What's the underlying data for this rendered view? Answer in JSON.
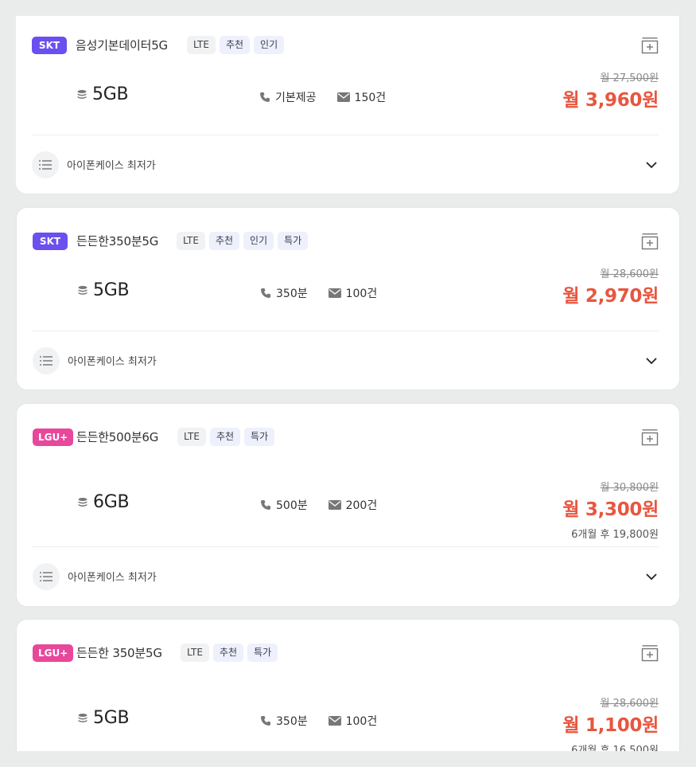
{
  "colors": {
    "skt": "#6b4ff0",
    "lgu": "#e8479b",
    "price": "#e8563f"
  },
  "icons": {
    "favorite": "add-to-list-icon",
    "data": "database-icon",
    "voice": "phone-icon",
    "sms": "mail-icon",
    "promo": "list-icon",
    "expand": "chevron-down-icon"
  },
  "plans": [
    {
      "carrier": "SKT",
      "name": "음성기본데이터5G",
      "tags": [
        "LTE",
        "추천",
        "인기"
      ],
      "data": "5GB",
      "voice": "기본제공",
      "sms": "150건",
      "original_price": "월 27,500원",
      "price": "월 3,960원",
      "after_price": "",
      "promo": "아이폰케이스 최저가"
    },
    {
      "carrier": "SKT",
      "name": "든든한350분5G",
      "tags": [
        "LTE",
        "추천",
        "인기",
        "특가"
      ],
      "data": "5GB",
      "voice": "350분",
      "sms": "100건",
      "original_price": "월 28,600원",
      "price": "월 2,970원",
      "after_price": "",
      "promo": "아이폰케이스 최저가"
    },
    {
      "carrier": "LGU+",
      "name": "든든한500분6G",
      "tags": [
        "LTE",
        "추천",
        "특가"
      ],
      "data": "6GB",
      "voice": "500분",
      "sms": "200건",
      "original_price": "월 30,800원",
      "price": "월 3,300원",
      "after_price": "6개월 후 19,800원",
      "promo": "아이폰케이스 최저가"
    },
    {
      "carrier": "LGU+",
      "name": "든든한 350분5G",
      "tags": [
        "LTE",
        "추천",
        "특가"
      ],
      "data": "5GB",
      "voice": "350분",
      "sms": "100건",
      "original_price": "월 28,600원",
      "price": "월 1,100원",
      "after_price": "6개월 후 16,500원",
      "promo": ""
    }
  ]
}
